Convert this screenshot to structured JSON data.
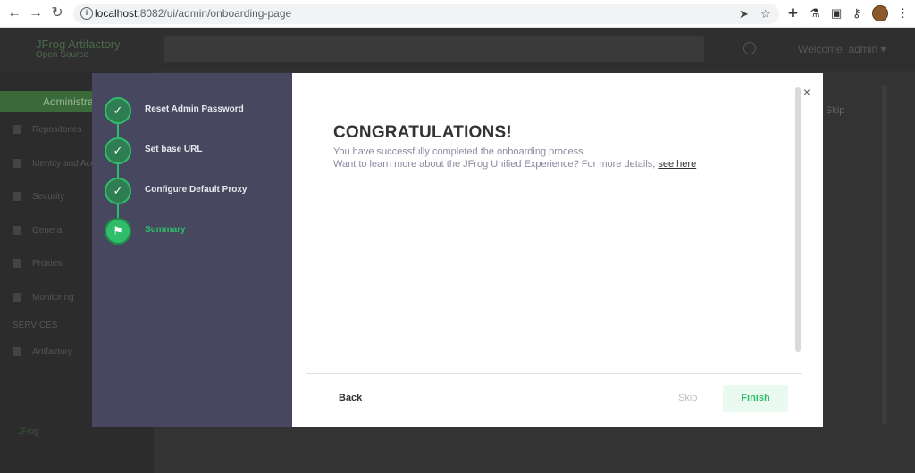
{
  "browser": {
    "back_glyph": "←",
    "forward_glyph": "→",
    "reload_glyph": "↻",
    "info_glyph": "i",
    "url_host": "localhost",
    "url_path": ":8082/ui/admin/onboarding-page",
    "send_glyph": "➤",
    "star_glyph": "☆",
    "puzzle_glyph": "✚",
    "flask_glyph": "⚗",
    "split_glyph": "▣",
    "key_glyph": "⚷",
    "menu_glyph": "⋮"
  },
  "stepper": {
    "check_glyph": "✓",
    "flag_glyph": "⚑",
    "steps": [
      {
        "label": "Reset Admin Password",
        "status": "done"
      },
      {
        "label": "Set base URL",
        "status": "done"
      },
      {
        "label": "Configure Default Proxy",
        "status": "done"
      },
      {
        "label": "Summary",
        "status": "active"
      }
    ]
  },
  "content": {
    "close_glyph": "×",
    "title": "CONGRATULATIONS!",
    "message_line1": "You have successfully completed the onboarding process.",
    "message_line2": "Want to learn more about the JFrog Unified Experience? For more details, ",
    "link_text": "see here"
  },
  "footer": {
    "back_label": "Back",
    "skip_label": "Skip",
    "finish_label": "Finish"
  },
  "colors": {
    "accent": "#2fbd6a",
    "stepper_bg": "#474860",
    "finish_bg": "#eafaf0"
  }
}
